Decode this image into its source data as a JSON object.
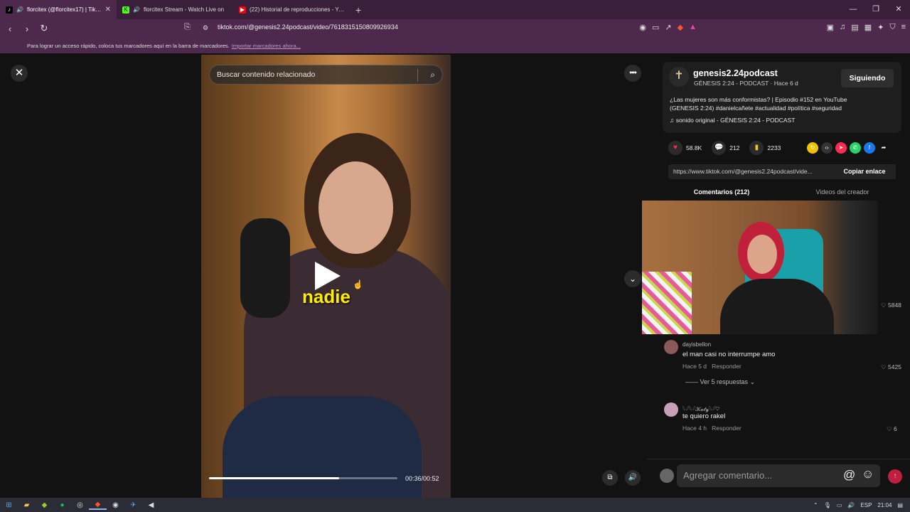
{
  "browser": {
    "tabs": [
      {
        "title": "florcitex (@florcitex17) | TikTo",
        "favicon": "tiktok-icon",
        "active": true,
        "audio": true
      },
      {
        "title": "florcitex Stream - Watch Live on",
        "favicon": "kick-icon",
        "active": false,
        "audio": true
      },
      {
        "title": "(22) Historial de reproducciones - You",
        "favicon": "youtube-icon",
        "active": false,
        "audio": false
      }
    ],
    "new_tab": "+",
    "url": "tiktok.com/@genesis2.24podcast/video/7618315150809926934",
    "bookmarks_hint": "Para lograr un acceso rápido, coloca tus marcadores aquí en la barra de marcadores.",
    "bookmarks_import": "Importar marcadores ahora..."
  },
  "video": {
    "search_placeholder": "Buscar contenido relacionado",
    "caption": "nadie",
    "time": "00:36/00:52",
    "progress": 0.69
  },
  "post": {
    "username": "genesis2.24podcast",
    "subtitle": "GÉNESIS 2:24 - PODCAST · Hace 6 d",
    "follow_label": "Siguiendo",
    "description": "¿Las mujeres son más conformistas? | Episodio #152 en YouTube (GENESIS 2:24) #danielcañete #actualidad #política #seguridad",
    "music": "sonido original - GÉNESIS 2:24 - PODCAST",
    "likes": "58.8K",
    "comments": "212",
    "saves": "2233",
    "link": "https://www.tiktok.com/@genesis2.24podcast/vide...",
    "copy_label": "Copiar enlace",
    "tab_comments": "Comentarios (212)",
    "tab_creator": "Videos del creador"
  },
  "comments": [
    {
      "likes": "5848"
    },
    {
      "name": "dayisbellon",
      "text": "el man casi no interrumpe amo",
      "time": "Hace 5 d",
      "reply": "Responder",
      "likes": "5425",
      "replies": "Ver 5 respuestas"
    },
    {
      "name": "𓆩𓆪𓆩𓆪𝒦𝒶𝓉𝓎𓆩𓆪♡",
      "text": "te quiero rakel",
      "time": "Hace 4 h",
      "reply": "Responder",
      "likes": "6"
    }
  ],
  "comment_input_placeholder": "Agregar comentario...",
  "taskbar": {
    "lang": "ESP",
    "clock": "21:04"
  },
  "colors": {
    "accent": "#fe2c55",
    "browser_frame": "#4d2a4d",
    "caption": "#ffee00"
  }
}
